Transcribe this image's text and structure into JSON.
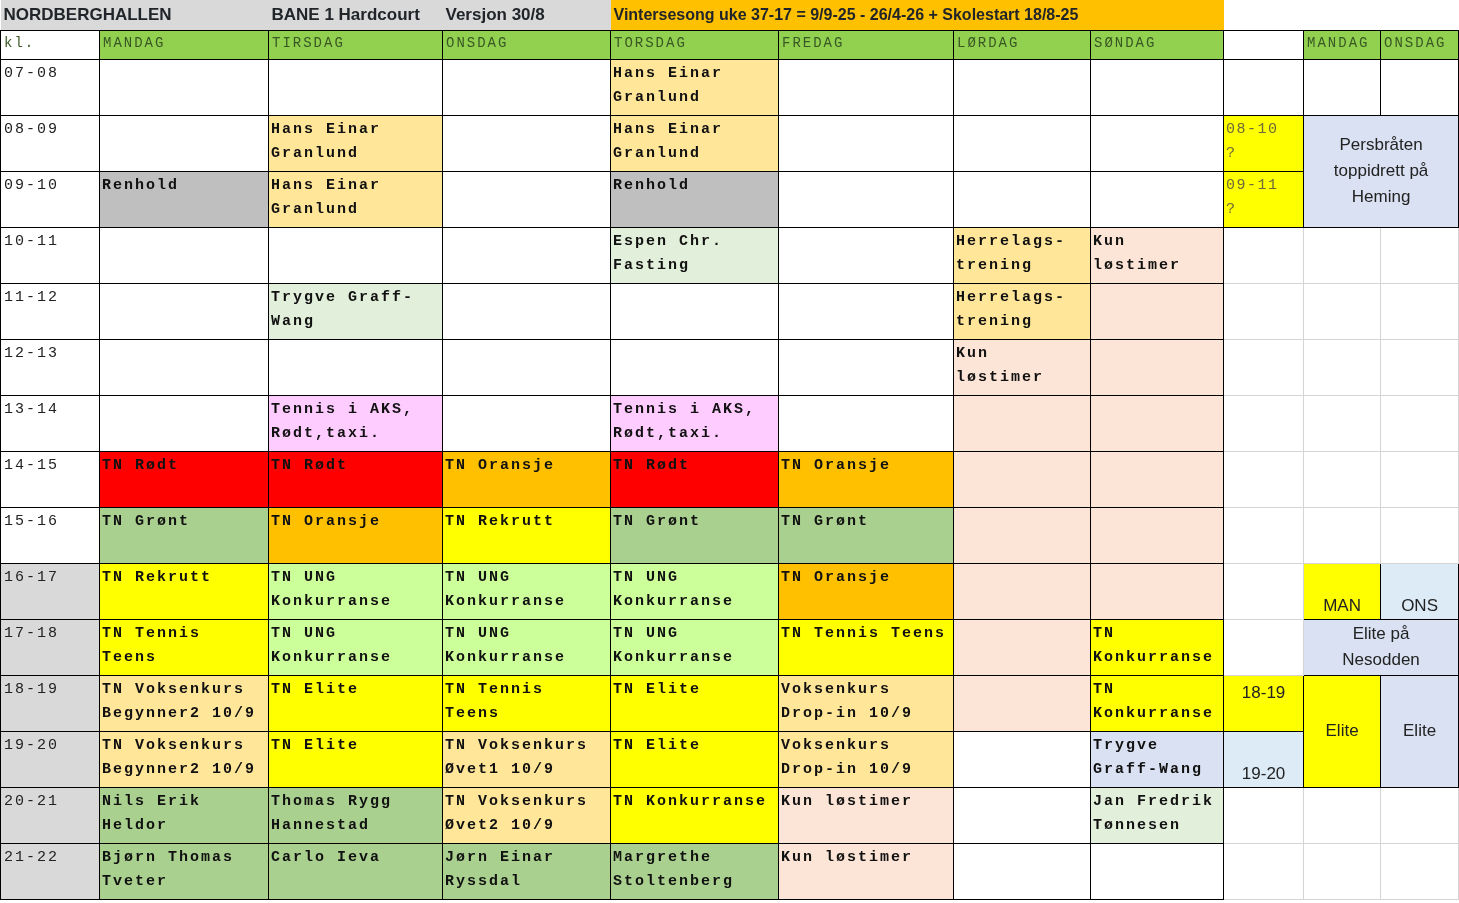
{
  "title_row": [
    {
      "text": "NORDBERGHALLEN",
      "color": "#d9d9d9",
      "colspan": 2
    },
    {
      "text": "BANE 1 Hardcourt",
      "color": "#d9d9d9"
    },
    {
      "text": "Versjon 30/8",
      "color": "#d9d9d9"
    },
    {
      "text": "Vintersesong uke 37-17 =  9/9-25 - 26/4-26 + Skolestart 18/8-25",
      "color": "#ffc000",
      "colspan": 4
    }
  ],
  "header_row": [
    {
      "text": "kl.",
      "color": "#ffffff"
    },
    {
      "text": "MANDAG",
      "color": "#92d050"
    },
    {
      "text": "TIRSDAG",
      "color": "#92d050"
    },
    {
      "text": "ONSDAG",
      "color": "#92d050"
    },
    {
      "text": "TORSDAG",
      "color": "#92d050"
    },
    {
      "text": "FREDAG",
      "color": "#92d050"
    },
    {
      "text": "LØRDAG",
      "color": "#92d050"
    },
    {
      "text": "SØNDAG",
      "color": "#92d050"
    },
    {
      "color": "#ffffff"
    },
    {
      "text": "MANDAG",
      "color": "#92d050"
    },
    {
      "text": "ONSDAG",
      "color": "#92d050"
    }
  ],
  "rows": [
    {
      "time": {
        "text": "07-08",
        "color": "#ffffff"
      },
      "cells": [
        {},
        {},
        {},
        {
          "text": "Hans Einar\nGranlund",
          "color": "#ffe699"
        },
        {},
        {},
        {},
        {
          "color": "#ffffff"
        },
        {
          "color": "#ffffff"
        },
        {
          "color": "#ffffff"
        }
      ]
    },
    {
      "time": {
        "text": "08-09",
        "color": "#ffffff"
      },
      "cells": [
        {},
        {
          "text": "Hans Einar\nGranlund",
          "color": "#ffe699"
        },
        {},
        {
          "text": "Hans Einar\nGranlund",
          "color": "#ffe699"
        },
        {},
        {},
        {},
        {
          "text": "08-10\n?",
          "color": "#ffff00",
          "kind": "note"
        },
        {
          "text": "Persbråten toppidrett på Heming",
          "color": "#d9e1f2",
          "kind": "center",
          "colspan": 2,
          "rowspan": 2
        }
      ]
    },
    {
      "time": {
        "text": "09-10",
        "color": "#ffffff"
      },
      "cells": [
        {
          "text": "Renhold",
          "color": "#bfbfbf"
        },
        {
          "text": "Hans Einar\nGranlund",
          "color": "#ffe699"
        },
        {},
        {
          "text": "Renhold",
          "color": "#bfbfbf"
        },
        {},
        {},
        {},
        {
          "text": "09-11\n?",
          "color": "#ffff00",
          "kind": "note"
        }
      ]
    },
    {
      "time": {
        "text": "10-11",
        "color": "#ffffff"
      },
      "cells": [
        {},
        {},
        {},
        {
          "text": "Espen Chr.\nFasting",
          "color": "#e2efda"
        },
        {},
        {
          "text": "Herrelags-\ntrening",
          "color": "#ffe699"
        },
        {
          "text": "Kun\nløstimer",
          "color": "#fce4d6"
        },
        {},
        {},
        {}
      ]
    },
    {
      "time": {
        "text": "11-12",
        "color": "#ffffff"
      },
      "cells": [
        {},
        {
          "text": "Trygve Graff-\nWang",
          "color": "#e2efda"
        },
        {},
        {},
        {},
        {
          "text": "Herrelags-\ntrening",
          "color": "#ffe699"
        },
        {
          "color": "#fce4d6"
        },
        {},
        {},
        {}
      ]
    },
    {
      "time": {
        "text": "12-13",
        "color": "#ffffff"
      },
      "cells": [
        {},
        {},
        {},
        {},
        {},
        {
          "text": "Kun\nløstimer",
          "color": "#fce4d6"
        },
        {
          "color": "#fce4d6"
        },
        {},
        {},
        {}
      ]
    },
    {
      "time": {
        "text": "13-14",
        "color": "#ffffff"
      },
      "cells": [
        {},
        {
          "text": "Tennis i AKS,\nRødt,taxi.",
          "color": "#ffccff"
        },
        {},
        {
          "text": "Tennis i AKS,\nRødt,taxi.",
          "color": "#ffccff"
        },
        {},
        {
          "color": "#fce4d6"
        },
        {
          "color": "#fce4d6"
        },
        {},
        {},
        {}
      ]
    },
    {
      "time": {
        "text": "14-15",
        "color": "#ffffff"
      },
      "cells": [
        {
          "text": "TN Rødt",
          "color": "#ff0000"
        },
        {
          "text": "TN Rødt",
          "color": "#ff0000"
        },
        {
          "text": "TN Oransje",
          "color": "#ffc000"
        },
        {
          "text": "TN Rødt",
          "color": "#ff0000"
        },
        {
          "text": "TN Oransje",
          "color": "#ffc000"
        },
        {
          "color": "#fce4d6"
        },
        {
          "color": "#fce4d6"
        },
        {},
        {},
        {}
      ]
    },
    {
      "time": {
        "text": "15-16",
        "color": "#ffffff"
      },
      "cells": [
        {
          "text": "TN Grønt",
          "color": "#a9d08e"
        },
        {
          "text": "TN Oransje",
          "color": "#ffc000"
        },
        {
          "text": "TN Rekrutt",
          "color": "#ffff00"
        },
        {
          "text": "TN Grønt",
          "color": "#a9d08e"
        },
        {
          "text": "TN Grønt",
          "color": "#a9d08e"
        },
        {
          "color": "#fce4d6"
        },
        {
          "color": "#fce4d6"
        },
        {},
        {},
        {}
      ]
    },
    {
      "time": {
        "text": "16-17",
        "color": "#d9d9d9"
      },
      "cells": [
        {
          "text": "TN Rekrutt",
          "color": "#ffff00"
        },
        {
          "text": "TN UNG\nKonkurranse",
          "color": "#ccff99"
        },
        {
          "text": "TN UNG\nKonkurranse",
          "color": "#ccff99"
        },
        {
          "text": "TN UNG\nKonkurranse",
          "color": "#ccff99"
        },
        {
          "text": "TN Oransje",
          "color": "#ffc000"
        },
        {
          "color": "#fce4d6"
        },
        {
          "color": "#fce4d6"
        },
        {},
        {
          "text": "MAN",
          "color": "#ffff00",
          "kind": "bottom"
        },
        {
          "text": "ONS",
          "color": "#ddebf7",
          "kind": "bottom"
        }
      ]
    },
    {
      "time": {
        "text": "17-18",
        "color": "#d9d9d9"
      },
      "cells": [
        {
          "text": "TN Tennis\nTeens",
          "color": "#ffff00"
        },
        {
          "text": "TN UNG\nKonkurranse",
          "color": "#ccff99"
        },
        {
          "text": "TN UNG\nKonkurranse",
          "color": "#ccff99"
        },
        {
          "text": "TN UNG\nKonkurranse",
          "color": "#ccff99"
        },
        {
          "text": "TN Tennis Teens",
          "color": "#ffff00"
        },
        {
          "color": "#fce4d6"
        },
        {
          "text": "TN\nKonkurranse",
          "color": "#ffff00"
        },
        {},
        {
          "text": "Elite på\nNesodden",
          "color": "#d9e1f2",
          "kind": "center",
          "colspan": 2
        }
      ]
    },
    {
      "time": {
        "text": "18-19",
        "color": "#d9d9d9"
      },
      "cells": [
        {
          "text": "TN Voksenkurs\nBegynner2 10/9",
          "color": "#ffe699"
        },
        {
          "text": "TN Elite",
          "color": "#ffff00"
        },
        {
          "text": "TN Tennis\nTeens",
          "color": "#ffff00"
        },
        {
          "text": "TN Elite",
          "color": "#ffff00"
        },
        {
          "text": "Voksenkurs\nDrop-in 10/9",
          "color": "#ffe699"
        },
        {
          "color": "#fce4d6"
        },
        {
          "text": "TN\nKonkurranse",
          "color": "#ffff00"
        },
        {
          "text": "18-19",
          "color": "#ffff00",
          "kind": "top"
        },
        {
          "text": "Elite",
          "color": "#ffff00",
          "kind": "center",
          "rowspan": 2
        },
        {
          "text": "Elite",
          "color": "#d9e1f2",
          "kind": "center",
          "rowspan": 2
        }
      ]
    },
    {
      "time": {
        "text": "19-20",
        "color": "#d9d9d9"
      },
      "cells": [
        {
          "text": "TN Voksenkurs\nBegynner2 10/9",
          "color": "#ffe699"
        },
        {
          "text": "TN Elite",
          "color": "#ffff00"
        },
        {
          "text": "TN Voksenkurs\nØvet1 10/9",
          "color": "#ffe699"
        },
        {
          "text": "TN Elite",
          "color": "#ffff00"
        },
        {
          "text": "Voksenkurs\nDrop-in 10/9",
          "color": "#ffe699"
        },
        {
          "color": "#ffffff"
        },
        {
          "text": "Trygve\nGraff-Wang",
          "color": "#d9e1f2"
        },
        {
          "text": "19-20",
          "color": "#ddebf7",
          "kind": "bottom"
        }
      ]
    },
    {
      "time": {
        "text": "20-21",
        "color": "#d9d9d9"
      },
      "cells": [
        {
          "text": "Nils Erik\nHeldor",
          "color": "#a9d08e"
        },
        {
          "text": "Thomas Rygg\nHannestad",
          "color": "#a9d08e"
        },
        {
          "text": "TN Voksenkurs\nØvet2 10/9",
          "color": "#ffe699"
        },
        {
          "text": "TN Konkurranse",
          "color": "#ffff00"
        },
        {
          "text": "Kun løstimer",
          "color": "#fce4d6"
        },
        {},
        {
          "text": "Jan Fredrik\nTønnesen",
          "color": "#e2efda"
        },
        {},
        {},
        {}
      ]
    },
    {
      "time": {
        "text": "21-22",
        "color": "#d9d9d9"
      },
      "cells": [
        {
          "text": "Bjørn Thomas\nTveter",
          "color": "#a9d08e"
        },
        {
          "text": "Carlo Ieva",
          "color": "#a9d08e"
        },
        {
          "text": "Jørn Einar\nRyssdal",
          "color": "#a9d08e"
        },
        {
          "text": "Margrethe\nStoltenberg",
          "color": "#a9d08e"
        },
        {
          "text": "Kun løstimer",
          "color": "#fce4d6"
        },
        {},
        {},
        {},
        {},
        {}
      ]
    }
  ]
}
